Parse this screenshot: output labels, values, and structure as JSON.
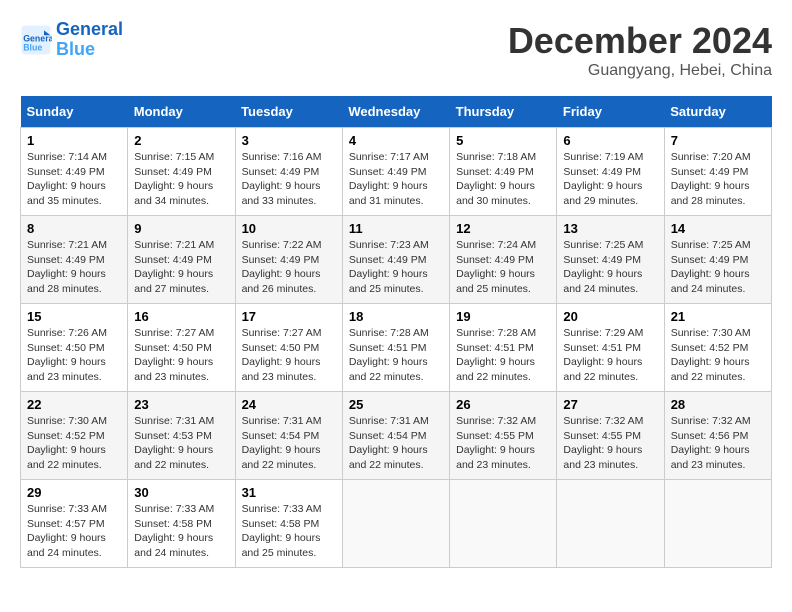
{
  "header": {
    "logo_line1": "General",
    "logo_line2": "Blue",
    "month_title": "December 2024",
    "subtitle": "Guangyang, Hebei, China"
  },
  "weekdays": [
    "Sunday",
    "Monday",
    "Tuesday",
    "Wednesday",
    "Thursday",
    "Friday",
    "Saturday"
  ],
  "weeks": [
    [
      {
        "day": "1",
        "sunrise": "7:14 AM",
        "sunset": "4:49 PM",
        "daylight": "9 hours and 35 minutes."
      },
      {
        "day": "2",
        "sunrise": "7:15 AM",
        "sunset": "4:49 PM",
        "daylight": "9 hours and 34 minutes."
      },
      {
        "day": "3",
        "sunrise": "7:16 AM",
        "sunset": "4:49 PM",
        "daylight": "9 hours and 33 minutes."
      },
      {
        "day": "4",
        "sunrise": "7:17 AM",
        "sunset": "4:49 PM",
        "daylight": "9 hours and 31 minutes."
      },
      {
        "day": "5",
        "sunrise": "7:18 AM",
        "sunset": "4:49 PM",
        "daylight": "9 hours and 30 minutes."
      },
      {
        "day": "6",
        "sunrise": "7:19 AM",
        "sunset": "4:49 PM",
        "daylight": "9 hours and 29 minutes."
      },
      {
        "day": "7",
        "sunrise": "7:20 AM",
        "sunset": "4:49 PM",
        "daylight": "9 hours and 28 minutes."
      }
    ],
    [
      {
        "day": "8",
        "sunrise": "7:21 AM",
        "sunset": "4:49 PM",
        "daylight": "9 hours and 28 minutes."
      },
      {
        "day": "9",
        "sunrise": "7:21 AM",
        "sunset": "4:49 PM",
        "daylight": "9 hours and 27 minutes."
      },
      {
        "day": "10",
        "sunrise": "7:22 AM",
        "sunset": "4:49 PM",
        "daylight": "9 hours and 26 minutes."
      },
      {
        "day": "11",
        "sunrise": "7:23 AM",
        "sunset": "4:49 PM",
        "daylight": "9 hours and 25 minutes."
      },
      {
        "day": "12",
        "sunrise": "7:24 AM",
        "sunset": "4:49 PM",
        "daylight": "9 hours and 25 minutes."
      },
      {
        "day": "13",
        "sunrise": "7:25 AM",
        "sunset": "4:49 PM",
        "daylight": "9 hours and 24 minutes."
      },
      {
        "day": "14",
        "sunrise": "7:25 AM",
        "sunset": "4:49 PM",
        "daylight": "9 hours and 24 minutes."
      }
    ],
    [
      {
        "day": "15",
        "sunrise": "7:26 AM",
        "sunset": "4:50 PM",
        "daylight": "9 hours and 23 minutes."
      },
      {
        "day": "16",
        "sunrise": "7:27 AM",
        "sunset": "4:50 PM",
        "daylight": "9 hours and 23 minutes."
      },
      {
        "day": "17",
        "sunrise": "7:27 AM",
        "sunset": "4:50 PM",
        "daylight": "9 hours and 23 minutes."
      },
      {
        "day": "18",
        "sunrise": "7:28 AM",
        "sunset": "4:51 PM",
        "daylight": "9 hours and 22 minutes."
      },
      {
        "day": "19",
        "sunrise": "7:28 AM",
        "sunset": "4:51 PM",
        "daylight": "9 hours and 22 minutes."
      },
      {
        "day": "20",
        "sunrise": "7:29 AM",
        "sunset": "4:51 PM",
        "daylight": "9 hours and 22 minutes."
      },
      {
        "day": "21",
        "sunrise": "7:30 AM",
        "sunset": "4:52 PM",
        "daylight": "9 hours and 22 minutes."
      }
    ],
    [
      {
        "day": "22",
        "sunrise": "7:30 AM",
        "sunset": "4:52 PM",
        "daylight": "9 hours and 22 minutes."
      },
      {
        "day": "23",
        "sunrise": "7:31 AM",
        "sunset": "4:53 PM",
        "daylight": "9 hours and 22 minutes."
      },
      {
        "day": "24",
        "sunrise": "7:31 AM",
        "sunset": "4:54 PM",
        "daylight": "9 hours and 22 minutes."
      },
      {
        "day": "25",
        "sunrise": "7:31 AM",
        "sunset": "4:54 PM",
        "daylight": "9 hours and 22 minutes."
      },
      {
        "day": "26",
        "sunrise": "7:32 AM",
        "sunset": "4:55 PM",
        "daylight": "9 hours and 23 minutes."
      },
      {
        "day": "27",
        "sunrise": "7:32 AM",
        "sunset": "4:55 PM",
        "daylight": "9 hours and 23 minutes."
      },
      {
        "day": "28",
        "sunrise": "7:32 AM",
        "sunset": "4:56 PM",
        "daylight": "9 hours and 23 minutes."
      }
    ],
    [
      {
        "day": "29",
        "sunrise": "7:33 AM",
        "sunset": "4:57 PM",
        "daylight": "9 hours and 24 minutes."
      },
      {
        "day": "30",
        "sunrise": "7:33 AM",
        "sunset": "4:58 PM",
        "daylight": "9 hours and 24 minutes."
      },
      {
        "day": "31",
        "sunrise": "7:33 AM",
        "sunset": "4:58 PM",
        "daylight": "9 hours and 25 minutes."
      },
      null,
      null,
      null,
      null
    ]
  ]
}
